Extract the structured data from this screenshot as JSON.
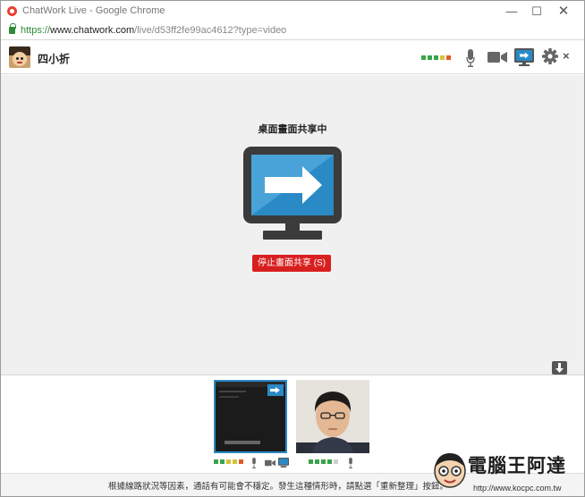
{
  "browser": {
    "title": "ChatWork Live - Google Chrome",
    "url_scheme": "https://",
    "url_host": "www.chatwork.com",
    "url_path": "/live/d53ff2fe99ac4612?type=video",
    "controls": {
      "minimize": "—",
      "maximize": "☐",
      "close": "✕"
    }
  },
  "header": {
    "user_name": "四小折",
    "signal_colors": [
      "#3aa34a",
      "#3aa34a",
      "#3aa34a",
      "#d6c23a",
      "#e15a2a"
    ],
    "close_label": "×",
    "icons": [
      "microphone-icon",
      "video-camera-icon",
      "screen-share-icon",
      "gear-icon",
      "close-icon"
    ]
  },
  "stage": {
    "share_title": "桌面畫面共享中",
    "stop_button": "停止畫面共享 (S)",
    "accent": "#2a8ac6",
    "stop_color": "#d81f1f"
  },
  "thumbnails": {
    "self_signal_colors": [
      "#3aa34a",
      "#3aa34a",
      "#d6c23a",
      "#d6c23a",
      "#e15a2a"
    ],
    "peer_signal_colors": [
      "#3aa34a",
      "#3aa34a",
      "#3aa34a",
      "#3aa34a",
      "#cfcfcf"
    ]
  },
  "notice": {
    "text": "根據線路狀況等因素，通話有可能會不穩定。發生這種情形時，請點選「重新整理」按鈕。"
  },
  "watermark": {
    "text": "電腦王阿達",
    "url": "http://www.kocpc.com.tw"
  }
}
